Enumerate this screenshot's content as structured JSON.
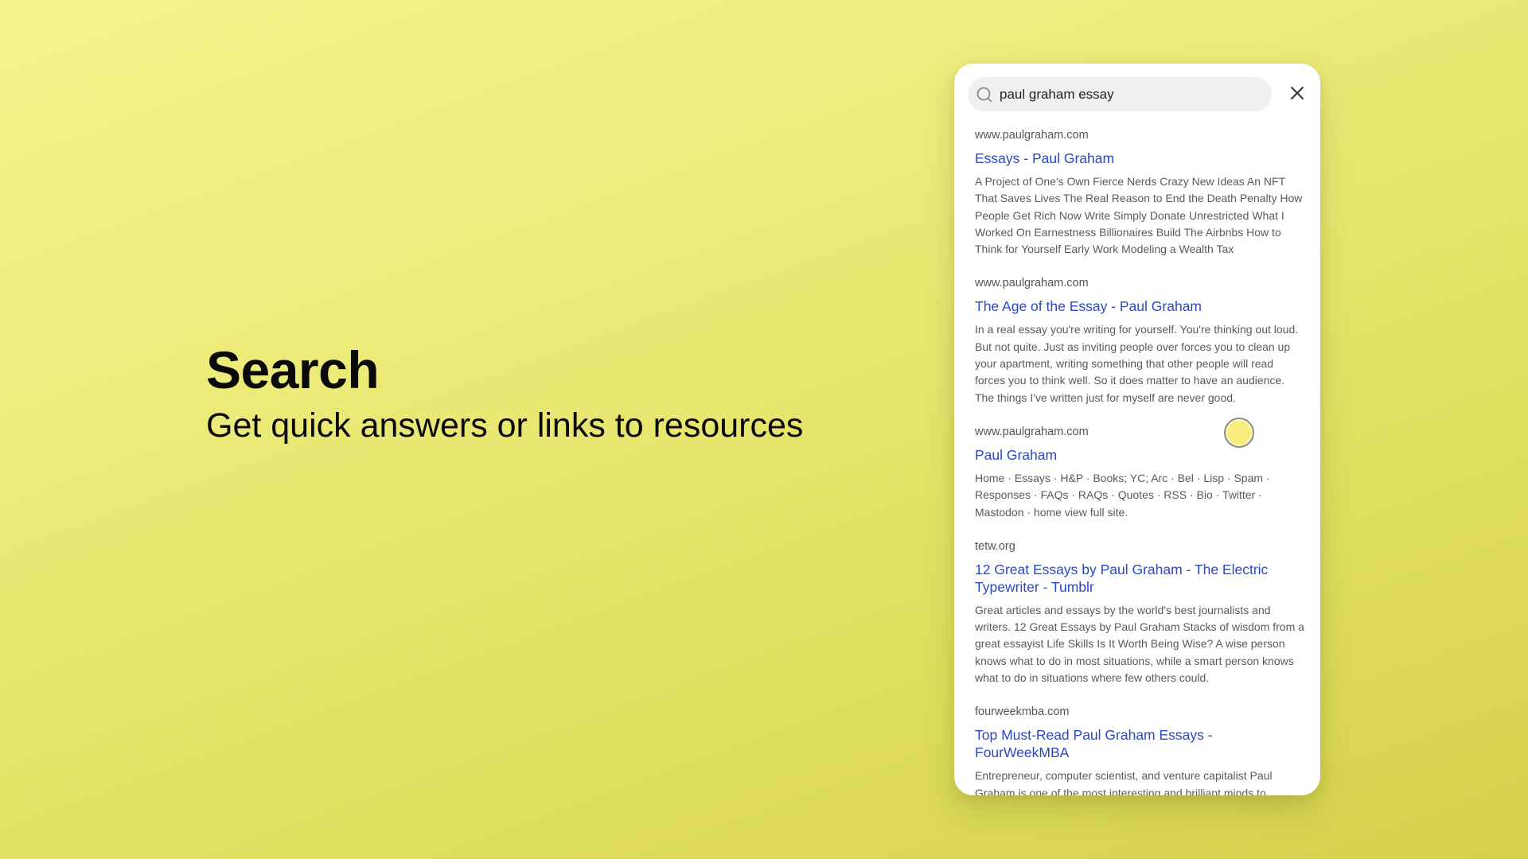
{
  "hero": {
    "title": "Search",
    "subtitle": "Get quick answers or links to resources"
  },
  "search": {
    "value": "paul graham essay",
    "icon": "search-icon",
    "close_icon": "close-icon"
  },
  "results": [
    {
      "domain": "www.paulgraham.com",
      "title": "Essays - Paul Graham",
      "snippet": "A Project of One's Own Fierce Nerds Crazy New Ideas An NFT That Saves Lives The Real Reason to End the Death Penalty How People Get Rich Now Write Simply Donate Unrestricted What I Worked On Earnestness Billionaires Build The Airbnbs How to Think for Yourself Early Work Modeling a Wealth Tax"
    },
    {
      "domain": "www.paulgraham.com",
      "title": "The Age of the Essay - Paul Graham",
      "snippet": "In a real essay you're writing for yourself. You're thinking out loud. But not quite. Just as inviting people over forces you to clean up your apartment, writing something that other people will read forces you to think well. So it does matter to have an audience. The things I've written just for myself are never good."
    },
    {
      "domain": "www.paulgraham.com",
      "title": "Paul Graham",
      "snippet": "Home · Essays · H&P · Books; YC; Arc · Bel · Lisp · Spam · Responses · FAQs · RAQs · Quotes · RSS · Bio · Twitter · Mastodon · home view full site."
    },
    {
      "domain": "tetw.org",
      "title": "12 Great Essays by Paul Graham - The Electric Typewriter - Tumblr",
      "snippet": "Great articles and essays by the world's best journalists and writers. 12 Great Essays by Paul Graham Stacks of wisdom from a great essayist Life Skills Is It Worth Being Wise? A wise person knows what to do in most situations, while a smart person knows what to do in situations where few others could."
    },
    {
      "domain": "fourweekmba.com",
      "title": "Top Must-Read Paul Graham Essays - FourWeekMBA",
      "snippet": "Entrepreneur, computer scientist, and venture capitalist Paul Graham is one of the most interesting and brilliant minds to"
    }
  ]
}
